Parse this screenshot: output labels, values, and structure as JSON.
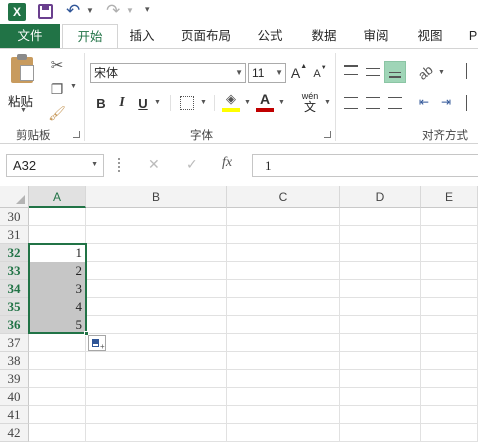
{
  "qat": {
    "icons": [
      "excel-logo",
      "save",
      "undo",
      "redo",
      "customize"
    ]
  },
  "tabs": [
    "文件",
    "开始",
    "插入",
    "页面布局",
    "公式",
    "数据",
    "审阅",
    "视图",
    "P"
  ],
  "ribbon": {
    "paste_label": "粘贴",
    "clipboard_label": "剪贴板",
    "font_group_label": "字体",
    "align_group_label": "对齐方式",
    "font_name": "宋体",
    "font_size": "11",
    "bold": "B",
    "italic": "I",
    "underline": "U",
    "grow_font": "A",
    "shrink_font": "A",
    "font_color_letter": "A",
    "wen": "wén",
    "wen_char": "文"
  },
  "formula_bar": {
    "name_box": "A32",
    "fx": "fx",
    "value": "1"
  },
  "sheet": {
    "columns": [
      "A",
      "B",
      "C",
      "D",
      "E"
    ],
    "rows": [
      "30",
      "31",
      "32",
      "33",
      "34",
      "35",
      "36",
      "37",
      "38",
      "39",
      "40",
      "41",
      "42"
    ],
    "selected_rows": [
      "32",
      "33",
      "34",
      "35",
      "36"
    ],
    "cell_values": [
      "1",
      "2",
      "3",
      "4",
      "5"
    ]
  },
  "colors": {
    "accent": "#217346",
    "selection_fill": "#c6c6c6",
    "header_bg": "#f3f3f3",
    "fill_yellow": "#ffff00",
    "font_red": "#c00000"
  }
}
